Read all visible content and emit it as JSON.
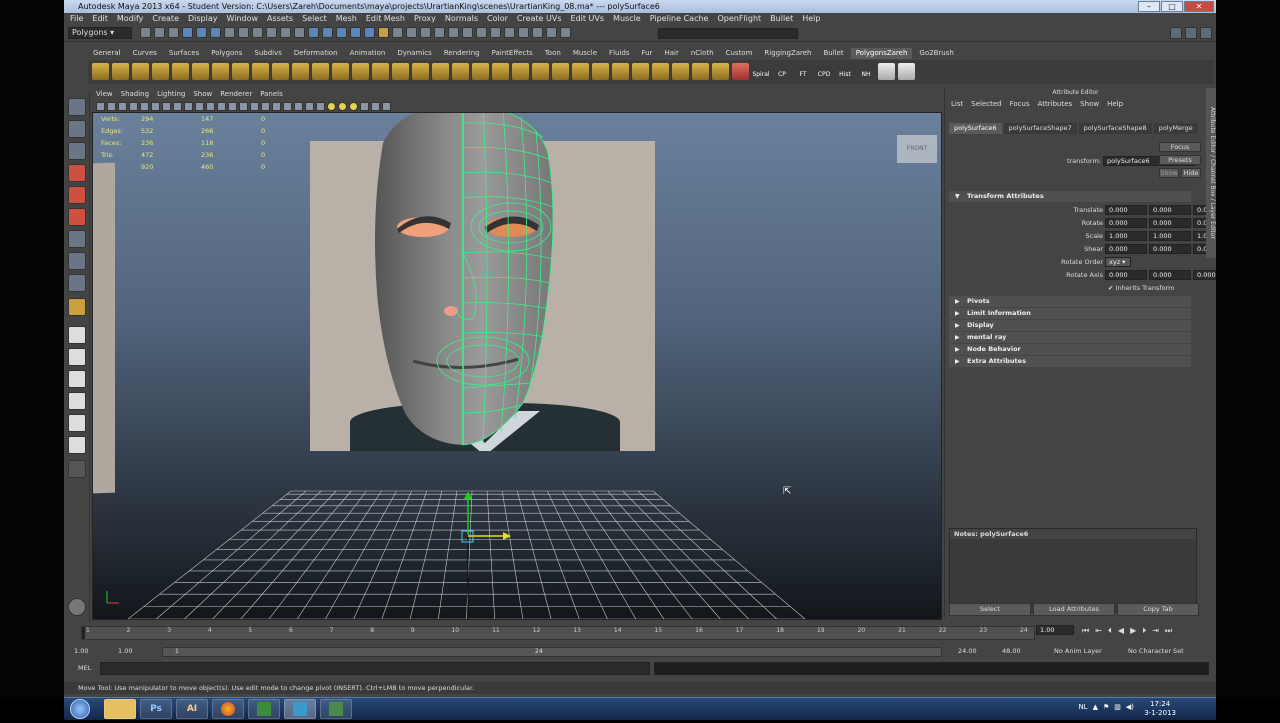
{
  "window": {
    "title": "Autodesk Maya 2013 x64 - Student Version: C:\\Users\\Zareh\\Documents\\maya\\projects\\UrartianKing\\scenes\\UrartianKing_08.ma* --- polySurface6"
  },
  "menus": [
    "File",
    "Edit",
    "Modify",
    "Create",
    "Display",
    "Window",
    "Assets",
    "Select",
    "Mesh",
    "Edit Mesh",
    "Proxy",
    "Normals",
    "Color",
    "Create UVs",
    "Edit UVs",
    "Muscle",
    "Pipeline Cache",
    "OpenFlight",
    "Bullet",
    "Help"
  ],
  "status": {
    "mode": "Polygons"
  },
  "shelf_tabs": [
    "General",
    "Curves",
    "Surfaces",
    "Polygons",
    "Subdivs",
    "Deformation",
    "Animation",
    "Dynamics",
    "Rendering",
    "PaintEffects",
    "Toon",
    "Muscle",
    "Fluids",
    "Fur",
    "Hair",
    "nCloth",
    "Custom",
    "RiggingZareh",
    "Bullet",
    "PolygonsZareh",
    "Go2Brush"
  ],
  "shelf_active": "PolygonsZareh",
  "shelf_labels": [
    "Spiral",
    "CP",
    "FT",
    "CPD",
    "Hist",
    "NH"
  ],
  "viewport": {
    "menus": [
      "View",
      "Shading",
      "Lighting",
      "Show",
      "Renderer",
      "Panels"
    ],
    "label": "FRONT",
    "hud": [
      {
        "k": "Verts:",
        "v1": "294",
        "v2": "147",
        "v3": "0"
      },
      {
        "k": "Edges:",
        "v1": "532",
        "v2": "266",
        "v3": "0"
      },
      {
        "k": "Faces:",
        "v1": "236",
        "v2": "118",
        "v3": "0"
      },
      {
        "k": "Tris:",
        "v1": "472",
        "v2": "236",
        "v3": "0"
      },
      {
        "k": "UVs:",
        "v1": "920",
        "v2": "460",
        "v3": "0"
      }
    ]
  },
  "attribute_editor": {
    "header": "Attribute Editor",
    "menus": [
      "List",
      "Selected",
      "Focus",
      "Attributes",
      "Show",
      "Help"
    ],
    "tabs": [
      "polySurface6",
      "polySurfaceShape7",
      "polySurfaceShape8",
      "polyMerge"
    ],
    "transform_label": "transform:",
    "transform_value": "polySurface6",
    "buttons": {
      "focus": "Focus",
      "presets": "Presets",
      "show": "Show",
      "hide": "Hide"
    },
    "section_transform": "Transform Attributes",
    "rows": [
      {
        "label": "Translate",
        "x": "0.000",
        "y": "0.000",
        "z": "0.000"
      },
      {
        "label": "Rotate",
        "x": "0.000",
        "y": "0.000",
        "z": "0.000"
      },
      {
        "label": "Scale",
        "x": "1.000",
        "y": "1.000",
        "z": "1.000"
      },
      {
        "label": "Shear",
        "x": "0.000",
        "y": "0.000",
        "z": "0.000"
      }
    ],
    "rotate_order_label": "Rotate Order",
    "rotate_order": "xyz",
    "rotate_axis": {
      "label": "Rotate Axis",
      "x": "0.000",
      "y": "0.000",
      "z": "0.000"
    },
    "inherits": "Inherits Transform",
    "sections": [
      "Pivots",
      "Limit Information",
      "Display",
      "mental ray",
      "Node Behavior",
      "Extra Attributes"
    ],
    "notes": "Notes: polySurface6",
    "bottom_buttons": [
      "Select",
      "Load Attributes",
      "Copy Tab"
    ],
    "side_tabs": "Attribute Editor / Channel Box / Layer Editor"
  },
  "timeline": {
    "ticks": [
      "1",
      "2",
      "3",
      "4",
      "5",
      "6",
      "7",
      "8",
      "9",
      "10",
      "11",
      "12",
      "13",
      "14",
      "15",
      "16",
      "17",
      "18",
      "19",
      "20",
      "21",
      "22",
      "23",
      "24"
    ],
    "current": "1.00"
  },
  "range": {
    "start": "1.00",
    "start2": "1.00",
    "slider_left": "1",
    "slider_right": "24",
    "end": "24.00",
    "end2": "48.00",
    "anim_layer": "No Anim Layer",
    "char_set": "No Character Set"
  },
  "cmdline": {
    "label": "MEL"
  },
  "help": "Move Tool: Use manipulator to move object(s). Use edit mode to change pivot (INSERT). Ctrl+LMB to move perpendicular.",
  "taskbar": {
    "lang": "NL",
    "time": "17:24",
    "date": "3-1-2013",
    "apps": [
      "Ps",
      "AI"
    ]
  }
}
